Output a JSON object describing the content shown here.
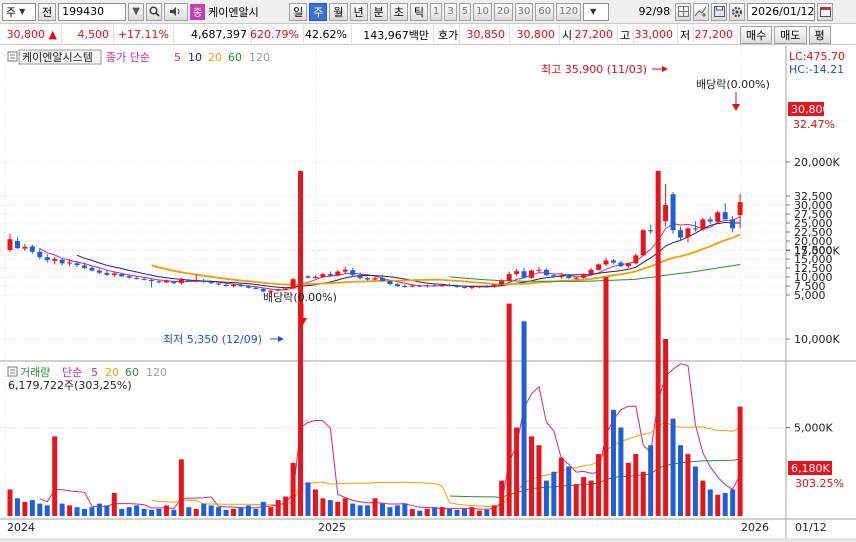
{
  "toolbar": {
    "market": "주",
    "prev_label": "전",
    "code": "199430",
    "stock_tag": "종",
    "stock_name": "케이엔알시",
    "periods": [
      "일",
      "주",
      "월",
      "년",
      "분",
      "초",
      "틱"
    ],
    "active_period": "주",
    "numbers": [
      "1",
      "3",
      "5",
      "10",
      "20",
      "30",
      "60",
      "120"
    ],
    "page": "92/98",
    "date": "2026/01/12"
  },
  "quote": {
    "price": "30,800",
    "change": "4,500",
    "change_pct": "+17.11%",
    "volume": "4,687,397",
    "vol_pct": "620.79%",
    "ratio": "42.62%",
    "amount": "143,967백만",
    "ask_label": "호가",
    "ask": "30,850",
    "bid": "30,800",
    "open_label": "시",
    "open": "27,200",
    "high_label": "고",
    "high": "33,000",
    "low_label": "저",
    "low": "27,200",
    "buy_label": "매수",
    "sell_label": "매도",
    "eval_label": "평"
  },
  "legend": {
    "name": "케이엔알시스템",
    "ma_title": "종가 단순",
    "ma_periods": [
      "5",
      "10",
      "20",
      "60",
      "120"
    ]
  },
  "volume_legend": {
    "title": "거래량",
    "ma_title": "단순",
    "ma_periods": [
      "5",
      "20",
      "60",
      "120"
    ],
    "info": "6,179,722주(303,25%)"
  },
  "labels": {
    "lc": "LC:475.70",
    "hc": "HC:-14.21",
    "high_annot": "최고 35,900 (11/03)",
    "low_annot": "최저 5,350 (12/09)",
    "div1": "배당락(0.00%)",
    "div2": "배당락(0.00%)",
    "price_tag": "30,800",
    "price_pct": "32.47%",
    "vol_tag": "6,180K",
    "vol_pct": "303.25%"
  },
  "price_axis": [
    "32,500",
    "30,000",
    "27,500",
    "25,000",
    "22,500",
    "20,000",
    "17,500",
    "15,000",
    "12,500",
    "10,000",
    "7,500",
    "5,000"
  ],
  "volume_axis": [
    "20,000K",
    "15,000K",
    "10,000K",
    "5,000K"
  ],
  "date_axis": [
    "2024",
    "2025",
    "2026",
    "01/12"
  ],
  "colors": {
    "up": "#e8141c",
    "down": "#1f5fd8",
    "ma5": "#d7267e",
    "ma10": "#1a237e",
    "ma20": "#f0a000",
    "ma60": "#2e8b3a",
    "ma120": "#9a9a9a"
  },
  "chart_data": {
    "type": "candlestick",
    "candles": [
      {
        "o": 17500,
        "h": 22000,
        "l": 17000,
        "c": 20500
      },
      {
        "o": 20000,
        "h": 21000,
        "l": 17800,
        "c": 18000
      },
      {
        "o": 17900,
        "h": 19200,
        "l": 17300,
        "c": 18400
      },
      {
        "o": 18500,
        "h": 19000,
        "l": 16500,
        "c": 17000
      },
      {
        "o": 17000,
        "h": 18000,
        "l": 15000,
        "c": 15500
      },
      {
        "o": 15500,
        "h": 16300,
        "l": 14000,
        "c": 14700
      },
      {
        "o": 14500,
        "h": 15500,
        "l": 13500,
        "c": 15000
      },
      {
        "o": 14800,
        "h": 15000,
        "l": 13200,
        "c": 13800
      },
      {
        "o": 13800,
        "h": 15000,
        "l": 13000,
        "c": 14000
      },
      {
        "o": 13800,
        "h": 14500,
        "l": 12800,
        "c": 13300
      },
      {
        "o": 13200,
        "h": 14000,
        "l": 12200,
        "c": 12500
      },
      {
        "o": 12500,
        "h": 13000,
        "l": 11500,
        "c": 11800
      },
      {
        "o": 11800,
        "h": 12300,
        "l": 10800,
        "c": 11200
      },
      {
        "o": 11100,
        "h": 11800,
        "l": 10300,
        "c": 10600
      },
      {
        "o": 10500,
        "h": 11500,
        "l": 10000,
        "c": 11000
      },
      {
        "o": 10800,
        "h": 11200,
        "l": 10000,
        "c": 10200
      },
      {
        "o": 10200,
        "h": 10500,
        "l": 9500,
        "c": 9800
      },
      {
        "o": 9700,
        "h": 10200,
        "l": 9300,
        "c": 9500
      },
      {
        "o": 9500,
        "h": 10000,
        "l": 9000,
        "c": 9200
      },
      {
        "o": 9200,
        "h": 9600,
        "l": 7100,
        "c": 8900
      },
      {
        "o": 8800,
        "h": 9300,
        "l": 8200,
        "c": 8500
      },
      {
        "o": 8500,
        "h": 9300,
        "l": 8300,
        "c": 8900
      },
      {
        "o": 8800,
        "h": 9000,
        "l": 8000,
        "c": 8300
      },
      {
        "o": 8300,
        "h": 9800,
        "l": 7800,
        "c": 9200
      },
      {
        "o": 9100,
        "h": 9500,
        "l": 8600,
        "c": 8900
      },
      {
        "o": 8900,
        "h": 10800,
        "l": 8500,
        "c": 9000
      },
      {
        "o": 9000,
        "h": 9500,
        "l": 8300,
        "c": 8600
      },
      {
        "o": 8600,
        "h": 8900,
        "l": 8000,
        "c": 8300
      },
      {
        "o": 8200,
        "h": 8600,
        "l": 7700,
        "c": 8000
      },
      {
        "o": 7800,
        "h": 8200,
        "l": 7300,
        "c": 7500
      },
      {
        "o": 7500,
        "h": 8000,
        "l": 7200,
        "c": 7800
      },
      {
        "o": 7800,
        "h": 8200,
        "l": 7300,
        "c": 7400
      },
      {
        "o": 7400,
        "h": 7800,
        "l": 6800,
        "c": 7000
      },
      {
        "o": 7000,
        "h": 7400,
        "l": 6500,
        "c": 6700
      },
      {
        "o": 6700,
        "h": 7100,
        "l": 5800,
        "c": 6000
      },
      {
        "o": 5900,
        "h": 6500,
        "l": 5350,
        "c": 6200
      },
      {
        "o": 6200,
        "h": 6800,
        "l": 6000,
        "c": 6500
      },
      {
        "o": 6500,
        "h": 7200,
        "l": 6200,
        "c": 6800
      },
      {
        "o": 6800,
        "h": 9800,
        "l": 6500,
        "c": 9400
      },
      {
        "o": 9400,
        "h": 11000,
        "l": 9000,
        "c": 10200
      },
      {
        "o": 10200,
        "h": 10500,
        "l": 9600,
        "c": 9800
      },
      {
        "o": 9800,
        "h": 10500,
        "l": 9500,
        "c": 10000
      },
      {
        "o": 10000,
        "h": 11200,
        "l": 9800,
        "c": 10800
      },
      {
        "o": 10800,
        "h": 11500,
        "l": 10200,
        "c": 10400
      },
      {
        "o": 10400,
        "h": 12000,
        "l": 10200,
        "c": 11500
      },
      {
        "o": 11500,
        "h": 12900,
        "l": 11000,
        "c": 12000
      },
      {
        "o": 11900,
        "h": 12500,
        "l": 10000,
        "c": 10600
      },
      {
        "o": 10600,
        "h": 11200,
        "l": 9400,
        "c": 9700
      },
      {
        "o": 9700,
        "h": 10000,
        "l": 8900,
        "c": 9300
      },
      {
        "o": 9300,
        "h": 10000,
        "l": 9100,
        "c": 9700
      },
      {
        "o": 9700,
        "h": 10200,
        "l": 8700,
        "c": 8900
      },
      {
        "o": 8900,
        "h": 9200,
        "l": 7700,
        "c": 8000
      },
      {
        "o": 8000,
        "h": 8300,
        "l": 7300,
        "c": 7500
      },
      {
        "o": 7500,
        "h": 8000,
        "l": 7000,
        "c": 7300
      },
      {
        "o": 7300,
        "h": 7800,
        "l": 7100,
        "c": 7600
      },
      {
        "o": 7600,
        "h": 8000,
        "l": 7200,
        "c": 7400
      },
      {
        "o": 7400,
        "h": 7900,
        "l": 7100,
        "c": 7700
      },
      {
        "o": 7700,
        "h": 8000,
        "l": 7300,
        "c": 7500
      },
      {
        "o": 7500,
        "h": 8000,
        "l": 7200,
        "c": 7800
      },
      {
        "o": 7800,
        "h": 8200,
        "l": 7400,
        "c": 7600
      },
      {
        "o": 7600,
        "h": 7900,
        "l": 7000,
        "c": 7200
      },
      {
        "o": 7200,
        "h": 7500,
        "l": 6800,
        "c": 7000
      },
      {
        "o": 7000,
        "h": 7400,
        "l": 6600,
        "c": 7200
      },
      {
        "o": 7200,
        "h": 7600,
        "l": 6900,
        "c": 7400
      },
      {
        "o": 7400,
        "h": 7800,
        "l": 7000,
        "c": 7300
      },
      {
        "o": 7300,
        "h": 8000,
        "l": 7000,
        "c": 7900
      },
      {
        "o": 7900,
        "h": 9400,
        "l": 7700,
        "c": 9000
      },
      {
        "o": 9000,
        "h": 11500,
        "l": 8800,
        "c": 10800
      },
      {
        "o": 10800,
        "h": 12200,
        "l": 10200,
        "c": 11600
      },
      {
        "o": 11600,
        "h": 12500,
        "l": 9500,
        "c": 9800
      },
      {
        "o": 9800,
        "h": 12000,
        "l": 9500,
        "c": 11800
      },
      {
        "o": 11800,
        "h": 12800,
        "l": 11200,
        "c": 12000
      },
      {
        "o": 12000,
        "h": 12400,
        "l": 10300,
        "c": 10500
      },
      {
        "o": 10500,
        "h": 11000,
        "l": 9800,
        "c": 10000
      },
      {
        "o": 10000,
        "h": 10800,
        "l": 9500,
        "c": 10300
      },
      {
        "o": 10300,
        "h": 10800,
        "l": 9500,
        "c": 9700
      },
      {
        "o": 9700,
        "h": 10000,
        "l": 9200,
        "c": 9800
      },
      {
        "o": 9800,
        "h": 11000,
        "l": 9500,
        "c": 10800
      },
      {
        "o": 10800,
        "h": 12500,
        "l": 10500,
        "c": 12000
      },
      {
        "o": 12000,
        "h": 13800,
        "l": 11800,
        "c": 13500
      },
      {
        "o": 13500,
        "h": 15300,
        "l": 13000,
        "c": 14600
      },
      {
        "o": 14600,
        "h": 15000,
        "l": 13500,
        "c": 14000
      },
      {
        "o": 14000,
        "h": 14500,
        "l": 12800,
        "c": 13000
      },
      {
        "o": 13000,
        "h": 14000,
        "l": 12500,
        "c": 13800
      },
      {
        "o": 13800,
        "h": 16500,
        "l": 13500,
        "c": 16000
      },
      {
        "o": 16000,
        "h": 23300,
        "l": 15800,
        "c": 23000
      },
      {
        "o": 23000,
        "h": 24500,
        "l": 22000,
        "c": 22700
      },
      {
        "o": 22700,
        "h": 26000,
        "l": 22500,
        "c": 25500
      },
      {
        "o": 25500,
        "h": 35900,
        "l": 24000,
        "c": 30000
      },
      {
        "o": 33000,
        "h": 33600,
        "l": 22000,
        "c": 23000
      },
      {
        "o": 23000,
        "h": 24000,
        "l": 20000,
        "c": 21000
      },
      {
        "o": 21000,
        "h": 24000,
        "l": 19600,
        "c": 23500
      },
      {
        "o": 23500,
        "h": 25500,
        "l": 22600,
        "c": 23200
      },
      {
        "o": 23200,
        "h": 26500,
        "l": 22800,
        "c": 26000
      },
      {
        "o": 26000,
        "h": 26800,
        "l": 24800,
        "c": 25400
      },
      {
        "o": 25400,
        "h": 28500,
        "l": 25000,
        "c": 28000
      },
      {
        "o": 28000,
        "h": 30500,
        "l": 27000,
        "c": 26000
      },
      {
        "o": 26000,
        "h": 27000,
        "l": 22400,
        "c": 23500
      },
      {
        "o": 27200,
        "h": 33000,
        "l": 23500,
        "c": 30800
      }
    ],
    "volume_k": [
      1500,
      1000,
      800,
      900,
      700,
      600,
      4500,
      700,
      600,
      500,
      400,
      500,
      700,
      600,
      1300,
      400,
      500,
      600,
      400,
      350,
      400,
      600,
      350,
      3200,
      500,
      400,
      700,
      600,
      500,
      350,
      400,
      500,
      600,
      400,
      800,
      500,
      900,
      1100,
      3000,
      19500,
      1900,
      1500,
      1000,
      900,
      800,
      1000,
      700,
      600,
      600,
      1000,
      700,
      500,
      600,
      700,
      400,
      300,
      400,
      500,
      500,
      400,
      350,
      400,
      500,
      300,
      350,
      600,
      2000,
      12000,
      5000,
      11000,
      4500,
      4000,
      2000,
      2500,
      3300,
      2800,
      1800,
      2200,
      2000,
      3500,
      13500,
      6000,
      5000,
      3000,
      3500,
      2500,
      4000,
      19500,
      10000,
      5500,
      4000,
      3500,
      2800,
      2000,
      1500,
      1200,
      1300,
      1500,
      6180
    ]
  }
}
